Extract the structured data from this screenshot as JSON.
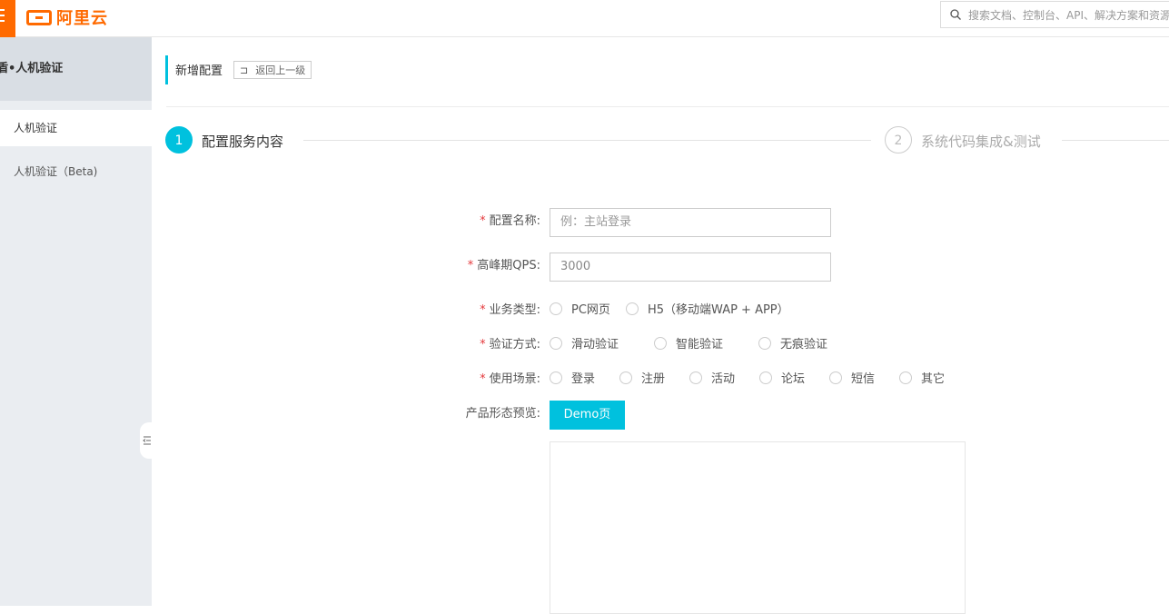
{
  "header": {
    "logo_text": "阿里云",
    "search_placeholder": "搜索文档、控制台、API、解决方案和资源"
  },
  "sidebar": {
    "title": "盾•人机验证",
    "items": [
      {
        "label": "人机验证",
        "active": true
      },
      {
        "label": "人机验证（Beta)",
        "active": false
      }
    ]
  },
  "page": {
    "title": "新增配置",
    "back_icon": "return-icon",
    "back_label": "返回上一级"
  },
  "steps": [
    {
      "number": "1",
      "label": "配置服务内容",
      "active": true
    },
    {
      "number": "2",
      "label": "系统代码集成&测试",
      "active": false
    }
  ],
  "form": {
    "required_mark": "*",
    "config_name": {
      "label": "配置名称:",
      "placeholder": "例：主站登录"
    },
    "peak_qps": {
      "label": "高峰期QPS:",
      "value": "3000"
    },
    "business_type": {
      "label": "业务类型:",
      "options": [
        "PC网页",
        "H5（移动端WAP + APP）"
      ]
    },
    "verify_method": {
      "label": "验证方式:",
      "options": [
        "滑动验证",
        "智能验证",
        "无痕验证"
      ]
    },
    "scene": {
      "label": "使用场景:",
      "options": [
        "登录",
        "注册",
        "活动",
        "论坛",
        "短信",
        "其它"
      ]
    },
    "preview": {
      "label": "产品形态预览:",
      "demo_button": "Demo页"
    }
  },
  "colors": {
    "brand": "#ff6a00",
    "accent": "#00c1de",
    "required": "#e4393c"
  }
}
